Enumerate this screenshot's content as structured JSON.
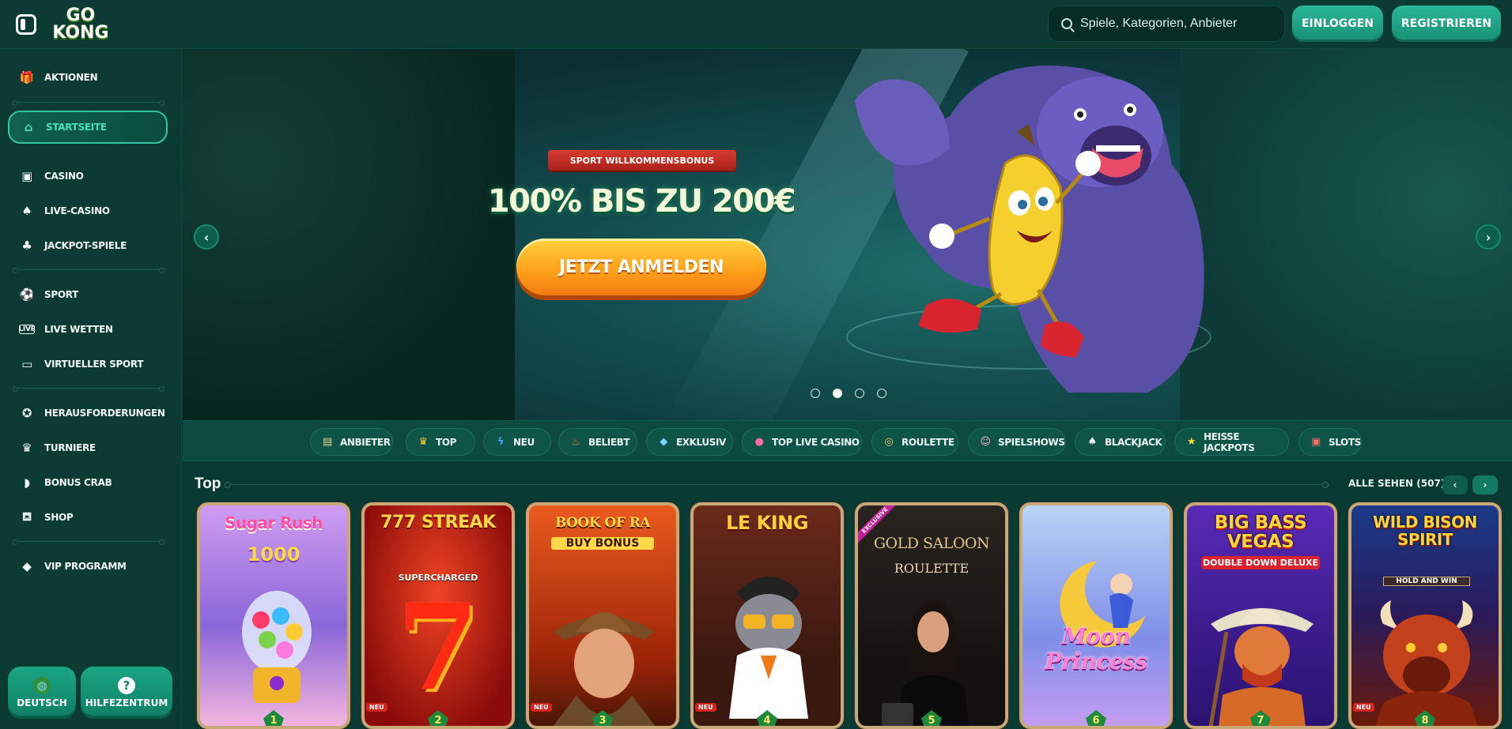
{
  "header": {
    "logo_line1": "GO",
    "logo_line2": "KONG",
    "search_placeholder": "Spiele, Kategorien, Anbieter",
    "login_label": "EINLOGGEN",
    "register_label": "REGISTRIEREN"
  },
  "sidebar": {
    "items": [
      {
        "label": "AKTIONEN",
        "icon": "gift-icon"
      },
      {
        "label": "STARTSEITE",
        "icon": "home-icon"
      },
      {
        "label": "CASINO",
        "icon": "slot-machine-icon"
      },
      {
        "label": "LIVE-CASINO",
        "icon": "card-icon"
      },
      {
        "label": "JACKPOT-SPIELE",
        "icon": "clover-icon"
      },
      {
        "label": "SPORT",
        "icon": "ball-icon"
      },
      {
        "label": "LIVE WETTEN",
        "icon": "live-icon"
      },
      {
        "label": "VIRTUELLER SPORT",
        "icon": "monitor-icon"
      },
      {
        "label": "HERAUSFORDERUNGEN",
        "icon": "medal-icon"
      },
      {
        "label": "TURNIERE",
        "icon": "trophy-icon"
      },
      {
        "label": "BONUS CRAB",
        "icon": "crab-icon"
      },
      {
        "label": "SHOP",
        "icon": "bag-icon"
      },
      {
        "label": "VIP PROGRAMM",
        "icon": "diamond-icon"
      }
    ],
    "language_label": "DEUTSCH",
    "help_label": "HILFEZENTRUM"
  },
  "hero": {
    "badge": "SPORT WILLKOMMENSBONUS",
    "title": "100% BIS ZU 200€",
    "cta": "JETZT ANMELDEN",
    "slides": 4,
    "active_slide": 2
  },
  "categories": [
    {
      "label": "ANBIETER",
      "icon": "scroll-icon"
    },
    {
      "label": "TOP",
      "icon": "crown-icon"
    },
    {
      "label": "NEU",
      "icon": "lightning-icon"
    },
    {
      "label": "BELIEBT",
      "icon": "fire-icon"
    },
    {
      "label": "EXKLUSIV",
      "icon": "gem-icon"
    },
    {
      "label": "TOP LIVE CASINO",
      "icon": "chip-icon"
    },
    {
      "label": "ROULETTE",
      "icon": "roulette-icon"
    },
    {
      "label": "SPIELSHOWS",
      "icon": "mic-icon"
    },
    {
      "label": "BLACKJACK",
      "icon": "cards-icon"
    },
    {
      "label": "HEISSE JACKPOTS",
      "icon": "jackpot-icon"
    },
    {
      "label": "SLOTS",
      "icon": "slots-icon"
    }
  ],
  "games_section": {
    "title": "Top",
    "see_all": "ALLE SEHEN (507)",
    "new_label": "NEU",
    "exclusive_label": "EXCLUSIVE",
    "games": [
      {
        "name": "Sugar Rush",
        "sub": "1000",
        "rank": "1",
        "new": false
      },
      {
        "name": "777 STREAK",
        "sub": "SUPERCHARGED",
        "rank": "2",
        "new": true
      },
      {
        "name": "BOOK OF RA",
        "sub": "BUY BONUS",
        "rank": "3",
        "new": true
      },
      {
        "name": "LE KING",
        "sub": "",
        "rank": "4",
        "new": true
      },
      {
        "name": "GOLD SALOON",
        "sub": "ROULETTE",
        "rank": "5",
        "new": false
      },
      {
        "name": "Moon Princess",
        "sub": "",
        "rank": "6",
        "new": false
      },
      {
        "name": "BIG BASS VEGAS",
        "sub": "DOUBLE DOWN DELUXE",
        "rank": "7",
        "new": false
      },
      {
        "name": "WILD BISON SPIRIT",
        "sub": "HOLD AND WIN",
        "rank": "8",
        "new": true
      }
    ]
  },
  "colors": {
    "background": "#093a32",
    "accent": "#2bb79a",
    "active": "#48e0b9",
    "cta": "#ffa21a"
  }
}
